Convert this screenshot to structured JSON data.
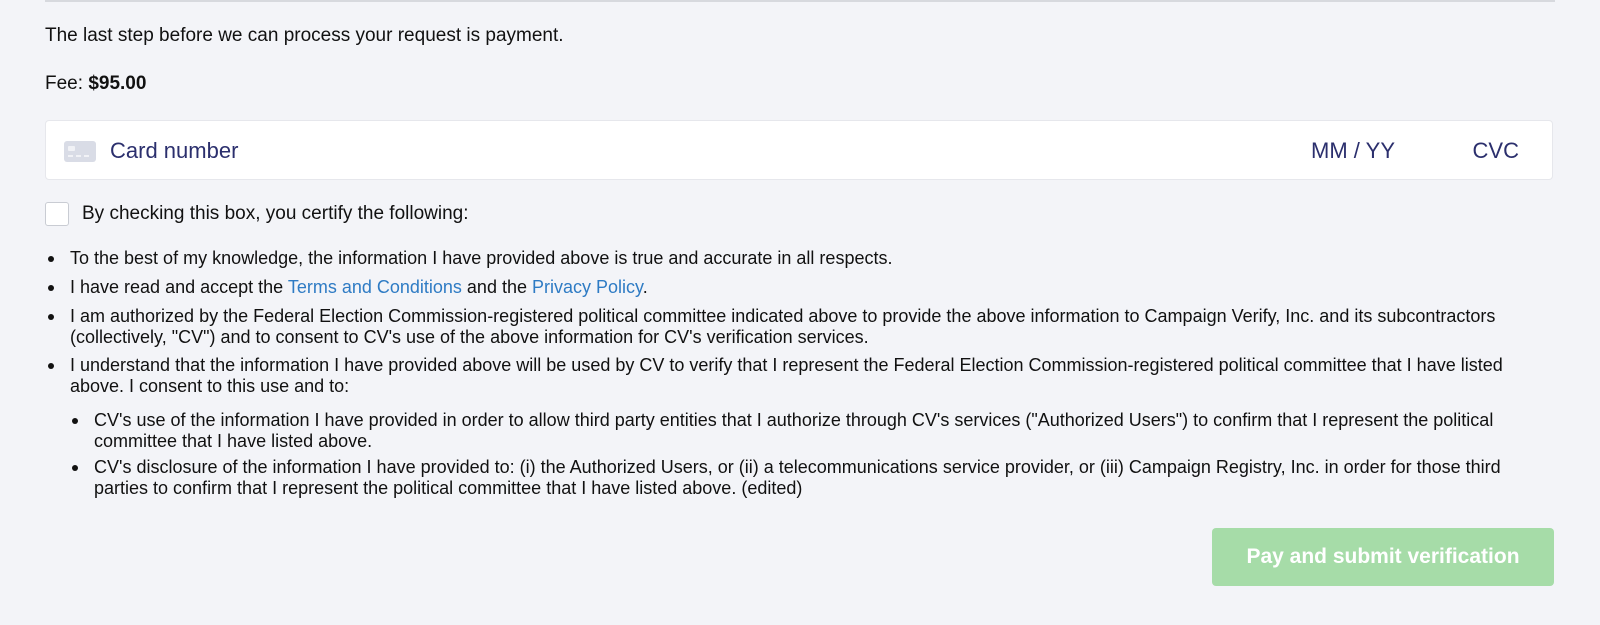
{
  "payment": {
    "intro": "The last step before we can process your request is payment.",
    "fee_label": "Fee:",
    "fee_amount": "$95.00"
  },
  "card": {
    "icon": "card-icon",
    "number_placeholder": "Card number",
    "expiry_placeholder": "MM / YY",
    "cvc_placeholder": "CVC",
    "placeholder_color": "#2b2f6d"
  },
  "certification": {
    "checkbox_label": "By checking this box, you certify the following:",
    "items": [
      {
        "text": "To the best of my knowledge, the information I have provided above is true and accurate in all respects."
      },
      {
        "prefix": "I have read and accept the ",
        "terms_link": "Terms and Conditions",
        "middle": " and the ",
        "privacy_link": "Privacy Policy",
        "suffix": "."
      },
      {
        "text": "I am authorized by the Federal Election Commission-registered political committee indicated above to provide the above information to Campaign Verify, Inc. and its subcontractors (collectively, \"CV\") and to consent to CV's use of the above information for CV's verification services."
      },
      {
        "text": "I understand that the information I have provided above will be used by CV to verify that I represent the Federal Election Commission-registered political committee that I have listed above. I consent to this use and to:"
      }
    ],
    "sub_items": [
      {
        "text": "CV's use of the information I have provided in order to allow third party entities that I authorize through CV's services (\"Authorized Users\") to confirm that I represent the political committee that I have listed above."
      },
      {
        "text": "CV's disclosure of the information I have provided to: (i) the Authorized Users, or (ii) a telecommunications service provider, or (iii) Campaign Registry, Inc. in order for those third parties to confirm that I represent the political committee that I have listed above. (edited)"
      }
    ]
  },
  "submit": {
    "label": "Pay and submit verification",
    "color": "#a6dca8"
  },
  "colors": {
    "background": "#f3f4f8",
    "link": "#2e7bc4"
  }
}
